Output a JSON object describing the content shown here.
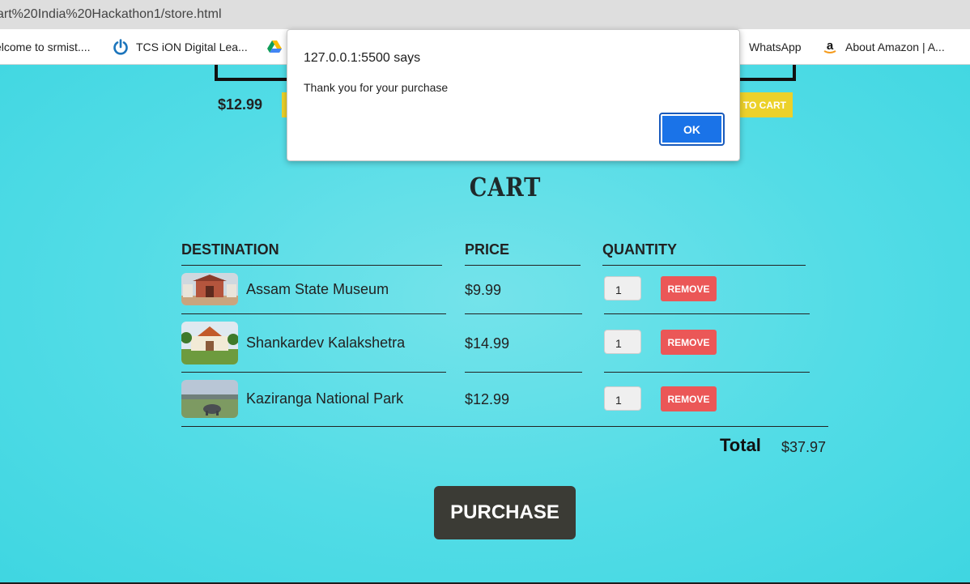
{
  "browser": {
    "url": "art%20India%20Hackathon1/store.html",
    "bookmarks": [
      {
        "label": "elcome to srmist...."
      },
      {
        "label": "TCS iON Digital Lea..."
      },
      {
        "label": ""
      },
      {
        "label": "WhatsApp"
      },
      {
        "label": "About Amazon | A..."
      }
    ]
  },
  "page_above": {
    "price": "$12.99",
    "add_to_cart_label": "TO CART"
  },
  "cart": {
    "title": "CART",
    "headers": {
      "destination": "DESTINATION",
      "price": "PRICE",
      "quantity": "QUANTITY"
    },
    "items": [
      {
        "name": "Assam State Museum",
        "price": "$9.99",
        "quantity": "1",
        "remove_label": "REMOVE"
      },
      {
        "name": "Shankardev Kalakshetra",
        "price": "$14.99",
        "quantity": "1",
        "remove_label": "REMOVE"
      },
      {
        "name": "Kaziranga National Park",
        "price": "$12.99",
        "quantity": "1",
        "remove_label": "REMOVE"
      }
    ],
    "total_label": "Total",
    "total_value": "$37.97",
    "purchase_label": "PURCHASE"
  },
  "dialog": {
    "title": "127.0.0.1:5500 says",
    "message": "Thank you for your purchase",
    "ok_label": "OK"
  },
  "colors": {
    "background": "#3fd7e2",
    "remove": "#eb5757",
    "add_to_cart": "#ecd12a",
    "purchase": "#3b3b35",
    "dialog_button": "#1a73e8"
  }
}
